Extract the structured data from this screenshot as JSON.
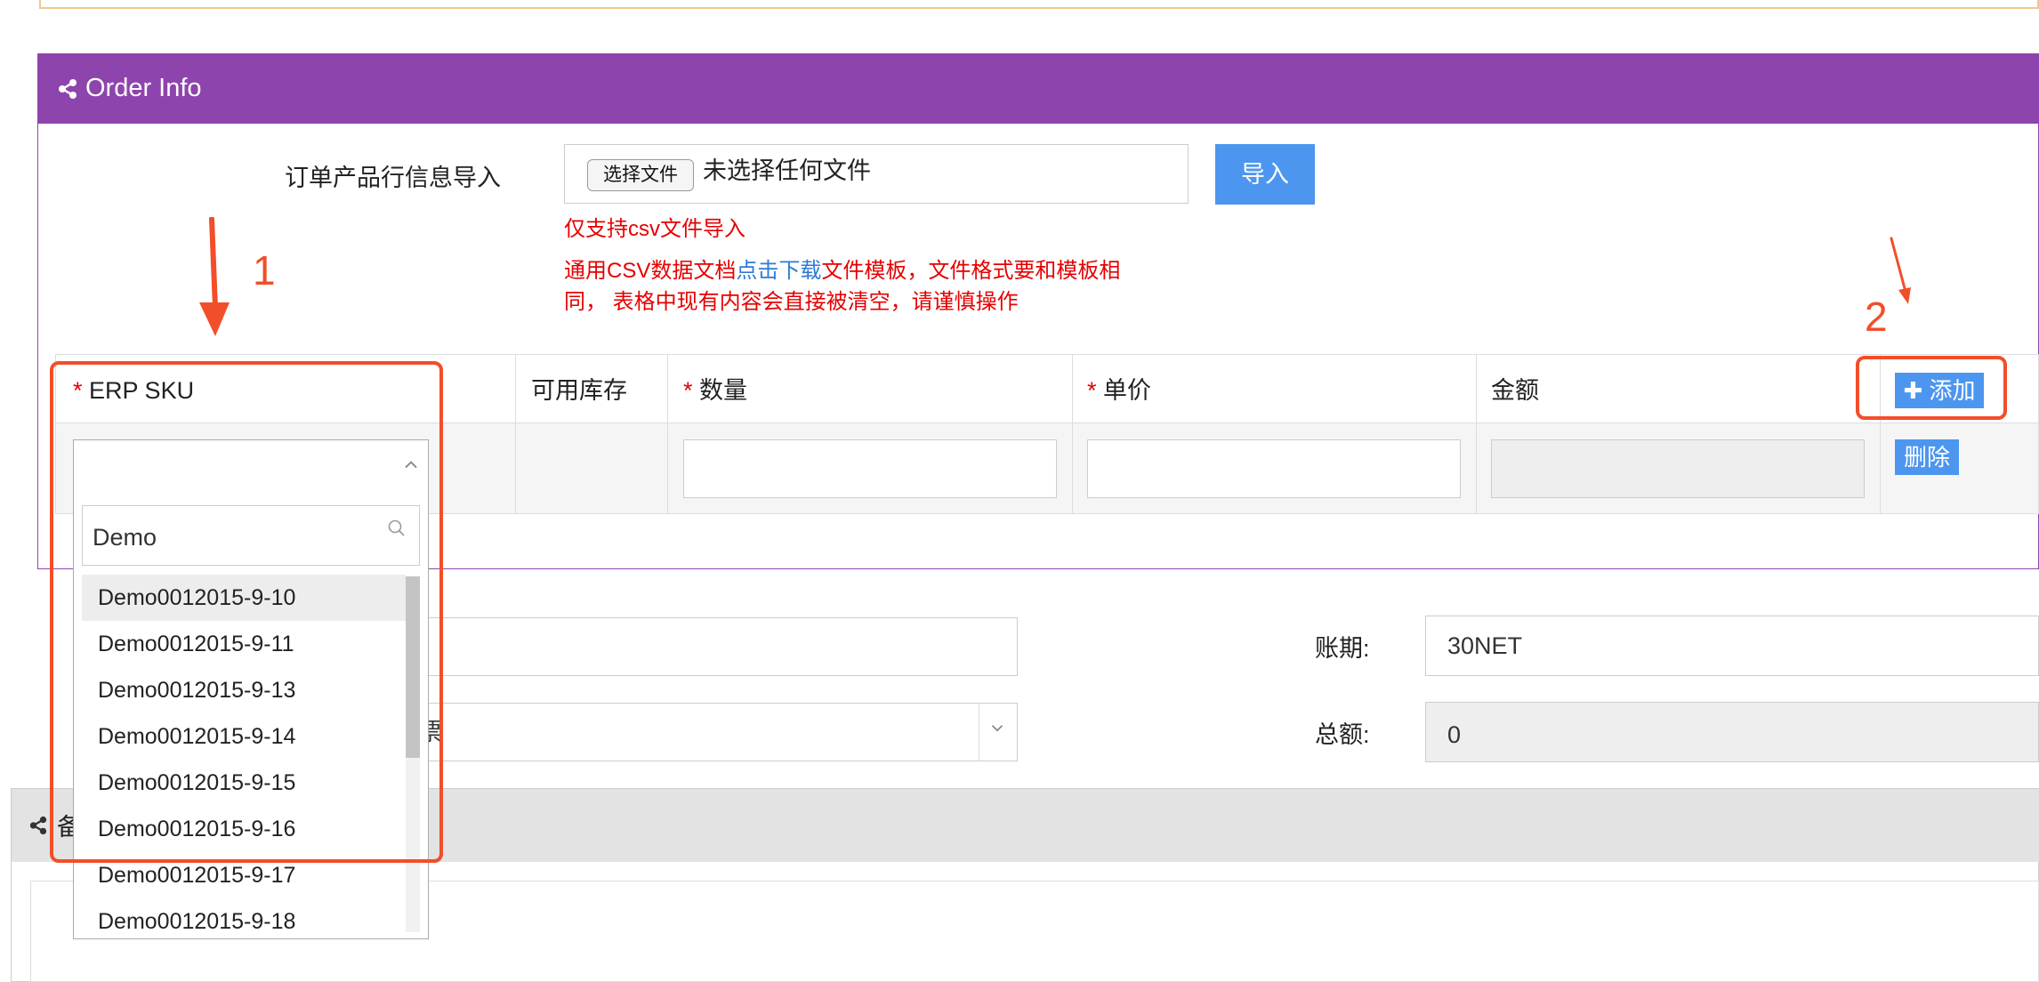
{
  "order_panel": {
    "title": "Order Info",
    "import_label": "订单产品行信息导入",
    "file_button": "选择文件",
    "file_status": "未选择任何文件",
    "import_button": "导入",
    "hint_csv_only": "仅支持csv文件导入",
    "hint_prefix": "通用CSV数据文档",
    "hint_link": "点击下载",
    "hint_suffix": "文件模板，文件格式要和模板相",
    "hint_line2": "同， 表格中现有内容会直接被清空，请谨慎操作"
  },
  "table": {
    "required_mark": "*",
    "headers": {
      "sku": "ERP SKU",
      "stock": "可用库存",
      "qty": "数量",
      "price": "单价",
      "amount": "金额"
    },
    "add_button": "添加",
    "delete_button": "删除"
  },
  "dropdown": {
    "search_value": "Demo",
    "options": [
      "Demo0012015-9-10",
      "Demo0012015-9-11",
      "Demo0012015-9-13",
      "Demo0012015-9-14",
      "Demo0012015-9-15",
      "Demo0012015-9-16",
      "Demo0012015-9-17",
      "Demo0012015-9-18"
    ]
  },
  "form": {
    "payment_term_label": "账期:",
    "payment_term_value": "30NET",
    "total_label": "总额:",
    "total_value": "0",
    "select_partial_text": "票"
  },
  "remarks_panel": {
    "title_partial": "备"
  },
  "annotations": {
    "marker_1": "1",
    "marker_2": "2",
    "color": "#f24e2a"
  },
  "colors": {
    "panel_header": "#8e44ad",
    "button_blue": "#4d96f0",
    "required_red": "#e60000",
    "link_blue": "#2e7ad6"
  }
}
